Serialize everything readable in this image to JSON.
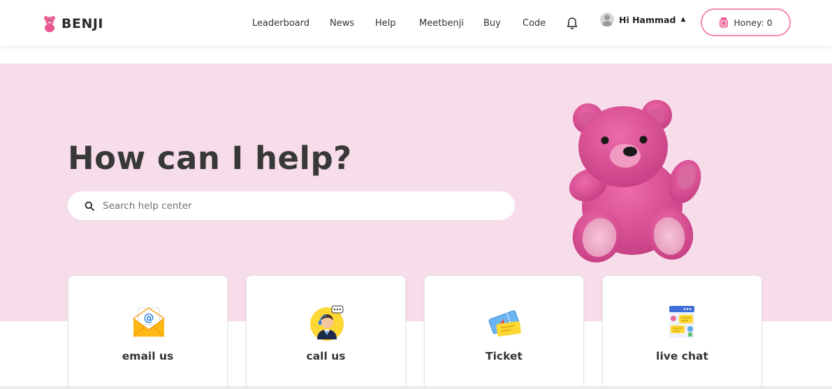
{
  "brand": {
    "name": "BENJI",
    "logo_icon": "bear-icon"
  },
  "nav": {
    "items": [
      {
        "label": "Leaderboard"
      },
      {
        "label": "News"
      },
      {
        "label": "Help"
      },
      {
        "label": "Meetbenji"
      },
      {
        "label": "Buy"
      },
      {
        "label": "Code"
      }
    ],
    "notification_icon": "bell-icon"
  },
  "user": {
    "greeting": "Hi Hammad",
    "caret_icon": "caret-up-icon"
  },
  "honey": {
    "label": "Honey: 0",
    "icon": "honey-jar-icon"
  },
  "hero": {
    "title": "How can I help?",
    "search": {
      "placeholder": "Search help center",
      "value": ""
    }
  },
  "cards": [
    {
      "label": "email us",
      "icon": "email-icon"
    },
    {
      "label": "call us",
      "icon": "call-agent-icon"
    },
    {
      "label": "Ticket",
      "icon": "ticket-icon"
    },
    {
      "label": "live chat",
      "icon": "live-chat-icon"
    }
  ],
  "colors": {
    "accent": "#f28ab0",
    "hero_bg": "#f7dce9",
    "bear": "#e04f9a",
    "text": "#333333"
  }
}
